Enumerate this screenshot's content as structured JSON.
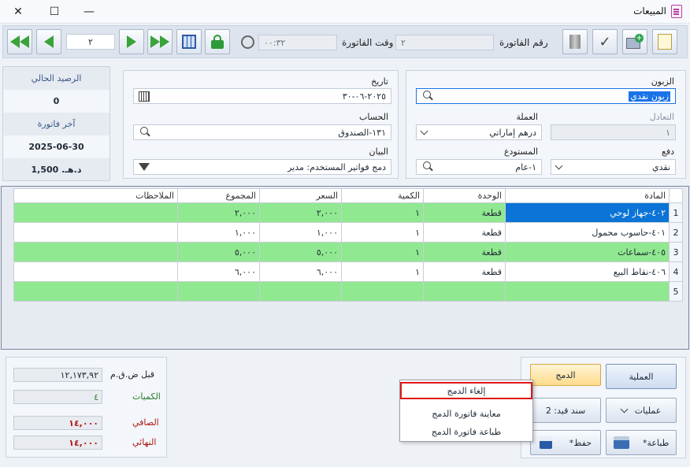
{
  "window": {
    "title": "المبيعات",
    "minimize": "—",
    "maximize": "☐",
    "close": "✕"
  },
  "toolbar": {
    "page_value": "٢",
    "invoice_no_label": "رقم الفاتورة",
    "invoice_no_value": "٢",
    "invoice_time_label": "وقت الفاتورة",
    "invoice_time_value": "٠٠:٣٢"
  },
  "side": {
    "balance_label": "الرصيد الحالي",
    "balance_value": "0",
    "last_invoice_label": "آخر فاتورة",
    "last_invoice_date": "2025-06-30",
    "last_invoice_amount": "1,500 .د.هـ"
  },
  "form": {
    "date_label": "تاريخ",
    "date_value": "٢٠٢٥-٠٦-٣٠",
    "account_label": "الحساب",
    "account_value": "١٣١-الصندوق",
    "statement_label": "البيان",
    "statement_value": "دمج فواتير المستخدم: مدير",
    "customer_label": "الزبون",
    "customer_value": "زبون نقدي",
    "currency_label": "العملة",
    "currency_value": "درهم إماراتي",
    "rate_label": "التعادل",
    "rate_value": "١",
    "warehouse_label": "المستودع",
    "warehouse_value": "١-عام",
    "payment_label": "دفع",
    "payment_value": "نقدي"
  },
  "grid": {
    "headers": [
      "المادة",
      "الوحدة",
      "الكمية",
      "السعر",
      "المجموع",
      "الملاحظات"
    ],
    "rows": [
      {
        "num": "1",
        "item": "٤٠٢-جهاز لوحي",
        "unit": "قطعة",
        "qty": "١",
        "price": "٢,٠٠٠",
        "total": "٢,٠٠٠",
        "notes": ""
      },
      {
        "num": "2",
        "item": "٤٠١-حاسوب محمول",
        "unit": "قطعة",
        "qty": "١",
        "price": "١,٠٠٠",
        "total": "١,٠٠٠",
        "notes": ""
      },
      {
        "num": "3",
        "item": "٤٠٥-سماعات",
        "unit": "قطعة",
        "qty": "١",
        "price": "٥,٠٠٠",
        "total": "٥,٠٠٠",
        "notes": ""
      },
      {
        "num": "4",
        "item": "٤٠٦-نقاط البيع",
        "unit": "قطعة",
        "qty": "١",
        "price": "٦,٠٠٠",
        "total": "٦,٠٠٠",
        "notes": ""
      },
      {
        "num": "5",
        "item": "",
        "unit": "",
        "qty": "",
        "price": "",
        "total": "",
        "notes": ""
      }
    ]
  },
  "totals": {
    "before_tax_label": "قبل ض.ق.م",
    "before_tax_value": "١٢,١٧٣,٩٢",
    "quantities_label": "الكميات",
    "quantities_value": "٤",
    "net_label": "الصافي",
    "net_value": "١٤,٠٠٠",
    "final_label": "النهائي",
    "final_value": "١٤,٠٠٠"
  },
  "actions": {
    "operation_label": "العملية",
    "merge_label": "الدمج",
    "operations_label": "عمليات",
    "voucher_label": "سند قيد: 2",
    "print_label": "طباعة*",
    "save_label": "حفظ*"
  },
  "menu": {
    "cancel_merge": "إلغاء الدمج",
    "preview_merge": "معاينة فاتورة الدمج",
    "print_merge": "طباعة فاتورة الدمج"
  },
  "colors": {
    "green_row": "#90e890",
    "selected": "#0b74d6",
    "menu_highlight": "#e01818",
    "net_text": "#b01818"
  }
}
